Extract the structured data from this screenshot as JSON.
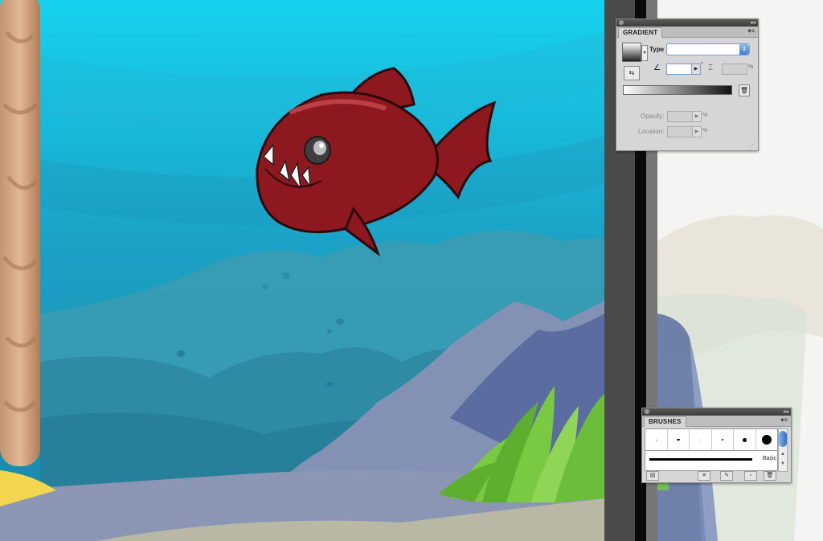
{
  "gradient_panel": {
    "tab_label": "GRADIENT",
    "menu_icon": "panel-menu-icon",
    "collapse_icon": "collapse-arrows-icon",
    "type_label": "Type",
    "type_value": "",
    "angle_value": "",
    "degree_symbol": "°",
    "aspect_value": "",
    "aspect_unit": "%",
    "opacity_label": "Opacity:",
    "opacity_value": "",
    "opacity_unit": "%",
    "location_label": "Location:",
    "location_value": "",
    "location_unit": "%",
    "gradient_start_color": "#ffffff",
    "gradient_end_color": "#111111"
  },
  "brushes_panel": {
    "tab_label": "BRUSHES",
    "menu_icon": "panel-menu-icon",
    "collapse_icon": "collapse-arrows-icon",
    "basic_label": "Basic",
    "brush_sizes_icon": "round-brush-tips"
  },
  "canvas": {
    "water_top_color": "#16d2ee",
    "water_mid_color": "#1ba4c6",
    "fish_body_color": "#8e1820",
    "grass_color": "#7ac943",
    "rock_color": "#8391b5",
    "sand_color": "#f2d64e"
  }
}
